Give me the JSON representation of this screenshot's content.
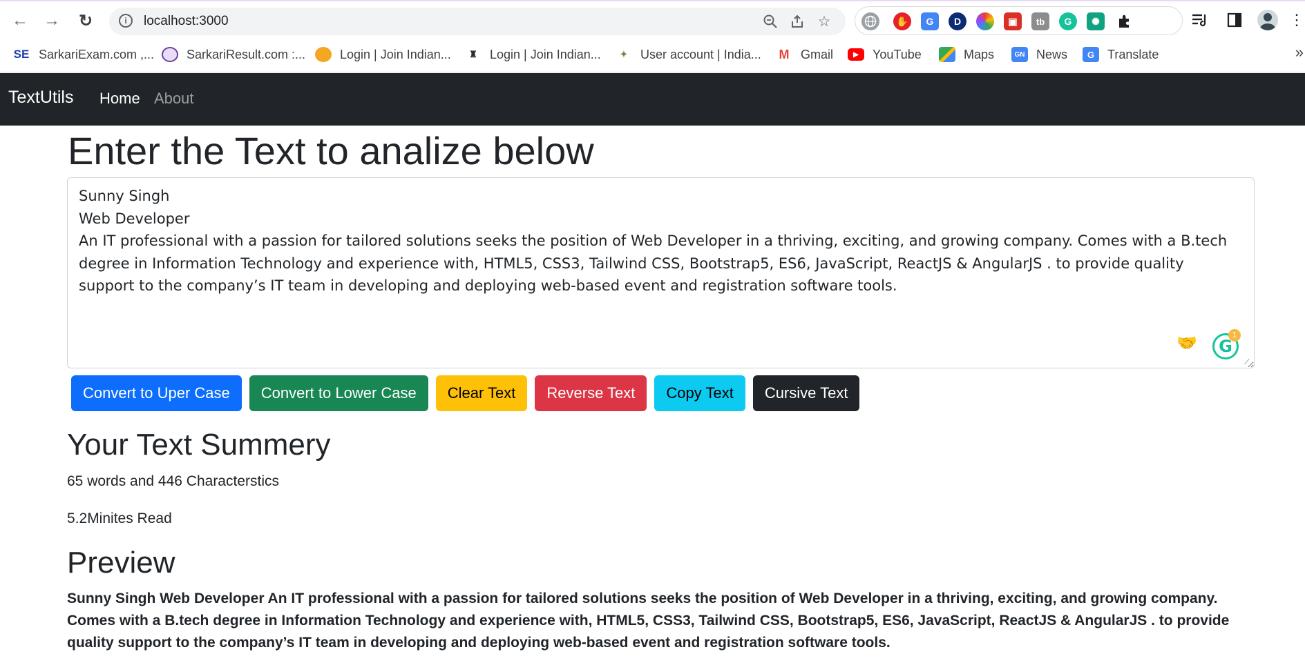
{
  "browser": {
    "url": "localhost:3000",
    "extensions": [
      "globe-icon",
      "adblock-icon",
      "google-translate-icon",
      "dashlane-icon",
      "color-picker-icon",
      "screen-recorder-icon",
      "tb-icon",
      "grammarly-icon",
      "chatgpt-icon",
      "extensions-puzzle-icon"
    ],
    "ext_labels": {
      "dashlane": "D",
      "tb": "tb",
      "grammarly": "G"
    },
    "bookmarks": [
      {
        "label": "SarkariExam.com ,...",
        "icon": "SE"
      },
      {
        "label": "SarkariResult.com :...",
        "icon": ""
      },
      {
        "label": "Login | Join Indian...",
        "icon": ""
      },
      {
        "label": "Login | Join Indian...",
        "icon": ""
      },
      {
        "label": "User account | India...",
        "icon": ""
      },
      {
        "label": "Gmail",
        "icon": "M"
      },
      {
        "label": "YouTube",
        "icon": ""
      },
      {
        "label": "Maps",
        "icon": ""
      },
      {
        "label": "News",
        "icon": ""
      },
      {
        "label": "Translate",
        "icon": ""
      }
    ],
    "bookmarks_more": "»"
  },
  "navbar": {
    "brand": "TextUtils",
    "links": [
      "Home",
      "About"
    ]
  },
  "main": {
    "heading": "Enter the Text to analize below",
    "textarea_lines": [
      "Sunny Singh",
      "Web Developer",
      "An IT professional with a passion for tailored solutions seeks the position of Web Developer in a thriving, exciting, and growing company. Comes with a B.tech degree in Information Technology and experience with, HTML5, CSS3, Tailwind CSS, Bootstrap5, ES6, JavaScript, ReactJS & AngularJS . to provide quality support to the company’s IT team in developing and deploying web-based event and registration software tools."
    ],
    "grammarly_count": "1",
    "buttons": [
      "Convert to Uper Case",
      "Convert to Lower Case",
      "Clear Text",
      "Reverse Text",
      "Copy Text",
      "Cursive Text"
    ]
  },
  "summary": {
    "heading": "Your Text Summery",
    "counts": "65 words and 446 Characterstics",
    "read_time": "5.2Minites Read"
  },
  "preview": {
    "heading": "Preview",
    "text": "Sunny Singh Web Developer An IT professional with a passion for tailored solutions seeks the position of Web Developer in a thriving, exciting, and growing company. Comes with a B.tech degree in Information Technology and experience with, HTML5, CSS3, Tailwind CSS, Bootstrap5, ES6, JavaScript, ReactJS & AngularJS . to provide quality support to the company’s IT team in developing and deploying web-based event and registration software tools."
  }
}
